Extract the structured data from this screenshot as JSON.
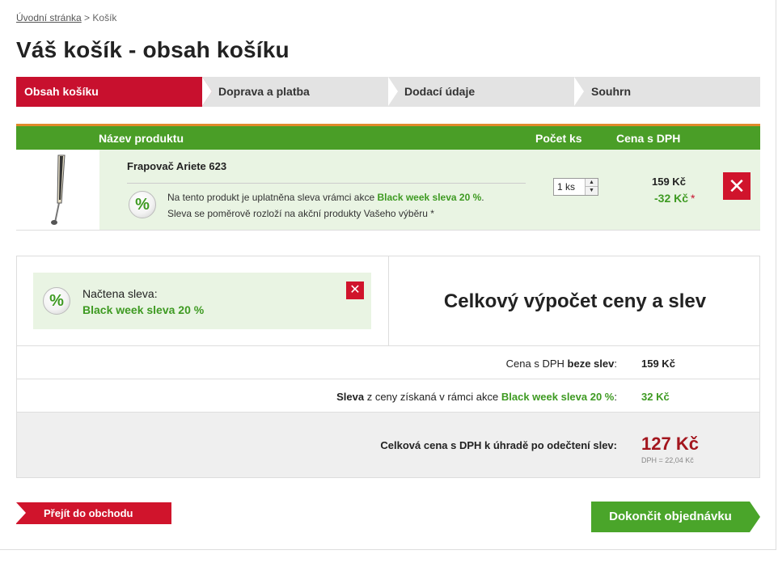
{
  "breadcrumb": {
    "home": "Úvodní stránka",
    "separator": " > ",
    "current": "Košík"
  },
  "page_title": "Váš košík - obsah košíku",
  "steps": [
    {
      "label": "Obsah košíku",
      "active": true
    },
    {
      "label": "Doprava a platba",
      "active": false
    },
    {
      "label": "Dodací údaje",
      "active": false
    },
    {
      "label": "Souhrn",
      "active": false
    }
  ],
  "cart": {
    "headers": {
      "product": "Název produktu",
      "qty": "Počet ks",
      "price": "Cena s DPH"
    },
    "item": {
      "name": "Frapovač Ariete 623",
      "discount_icon": "%",
      "note_prefix": "Na tento produkt je uplatněna sleva vrámci akce ",
      "note_campaign": "Black week sleva 20 %",
      "note_suffix": ".",
      "note_line2": "Sleva se poměrově rozloží na akční produkty Vašeho výběru *",
      "qty_value": "1 ks",
      "price": "159 Kč",
      "discount": "-32 Kč",
      "discount_star": "*",
      "remove_icon": "✕"
    }
  },
  "coupon": {
    "label": "Načtena sleva:",
    "name": "Black week sleva 20 %",
    "remove_icon": "✕"
  },
  "summary": {
    "title": "Celkový výpočet ceny a slev",
    "row1_label_prefix": "Cena s DPH ",
    "row1_label_bold": "beze slev",
    "row1_label_suffix": ":",
    "row1_value": "159 Kč",
    "row2_label_bold": "Sleva",
    "row2_label_middle": " z ceny získaná v rámci akce ",
    "row2_label_campaign": "Black week sleva 20 %",
    "row2_label_suffix": ":",
    "row2_value": "32 Kč",
    "total_label": "Celková cena s DPH k úhradě po odečtení slev:",
    "total_value": "127 Kč",
    "vat": "DPH = 22,04 Kč"
  },
  "buttons": {
    "back": "Přejít do obchodu",
    "finish": "Dokončit objednávku"
  },
  "colors": {
    "brand_red": "#d0142c",
    "green": "#4a9e27",
    "price_red": "#a3161e"
  }
}
